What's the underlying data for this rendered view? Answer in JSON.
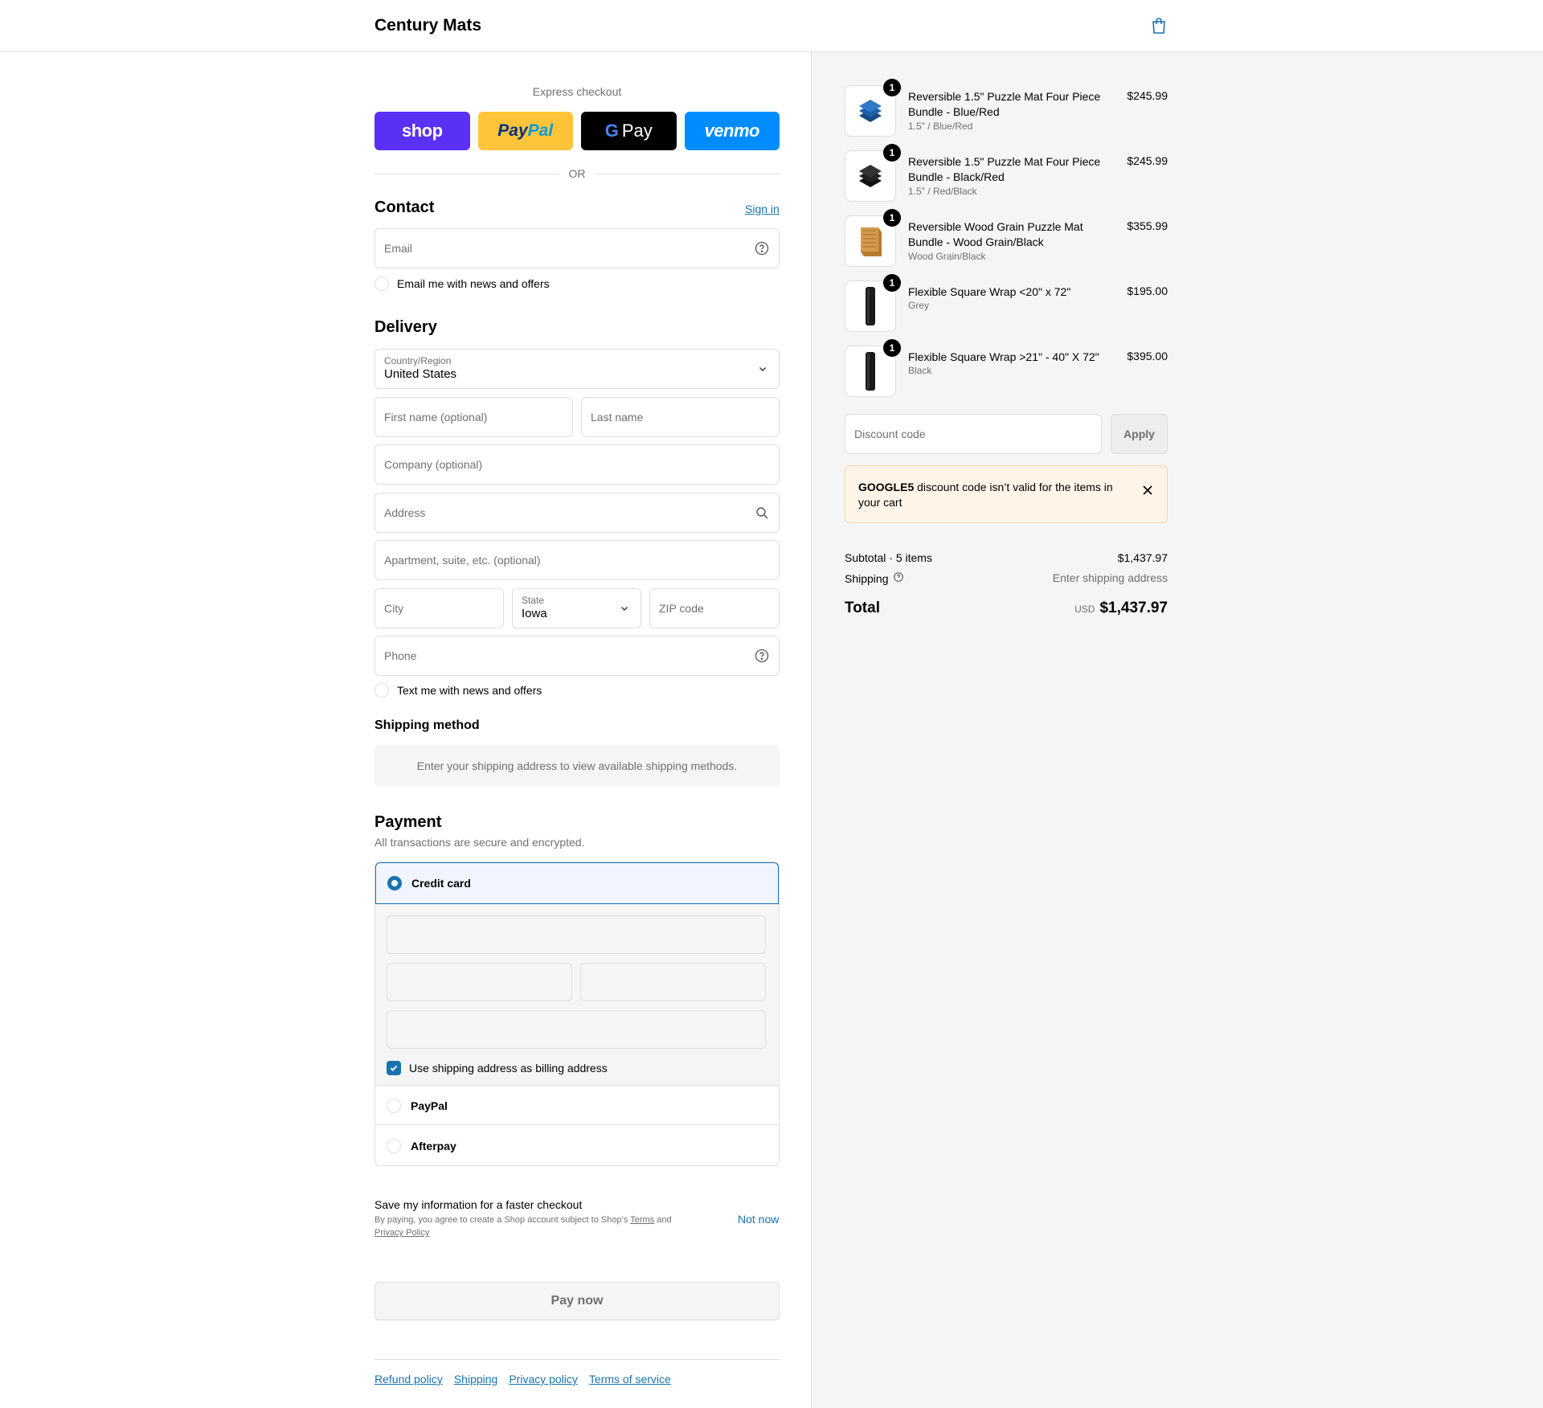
{
  "header": {
    "brand": "Century Mats",
    "cart_icon": "shopping-bag-icon"
  },
  "express": {
    "title": "Express checkout",
    "buttons": {
      "shop": "shop",
      "paypal_a": "Pay",
      "paypal_b": "Pal",
      "gpay_g": "G",
      "gpay": "Pay",
      "venmo": "venmo"
    },
    "or": "OR"
  },
  "contact": {
    "title": "Contact",
    "sign_in": "Sign in",
    "email_placeholder": "Email",
    "news_label": "Email me with news and offers"
  },
  "delivery": {
    "title": "Delivery",
    "country_label": "Country/Region",
    "country_value": "United States",
    "first_name": "First name (optional)",
    "last_name": "Last name",
    "company": "Company (optional)",
    "address": "Address",
    "apartment": "Apartment, suite, etc. (optional)",
    "city": "City",
    "state_label": "State",
    "state_value": "Iowa",
    "zip": "ZIP code",
    "phone": "Phone",
    "text_label": "Text me with news and offers"
  },
  "shipping_method": {
    "title": "Shipping method",
    "message": "Enter your shipping address to view available shipping methods."
  },
  "payment": {
    "title": "Payment",
    "subtitle": "All transactions are secure and encrypted.",
    "credit_card": "Credit card",
    "billing_label": "Use shipping address as billing address",
    "paypal": "PayPal",
    "afterpay": "Afterpay"
  },
  "save_info": {
    "title": "Save my information for a faster checkout",
    "sub_a": "By paying, you agree to create a Shop account subject to Shop’s ",
    "terms": "Terms",
    "sub_b": " and",
    "privacy": "Privacy Policy",
    "not_now": "Not now"
  },
  "pay_now": "Pay now",
  "footer": {
    "links": [
      "Refund policy",
      "Shipping",
      "Privacy policy",
      "Terms of service"
    ]
  },
  "cart": {
    "items": [
      {
        "qty": "1",
        "name": "Reversible 1.5\" Puzzle Mat Four Piece Bundle - Blue/Red",
        "variant": "1.5\" / Blue/Red",
        "price": "$245.99",
        "color": "#1f5fa8"
      },
      {
        "qty": "1",
        "name": "Reversible 1.5\" Puzzle Mat Four Piece Bundle - Black/Red",
        "variant": "1.5\" / Red/Black",
        "price": "$245.99",
        "color": "#222222"
      },
      {
        "qty": "1",
        "name": "Reversible Wood Grain Puzzle Mat Bundle - Wood Grain/Black",
        "variant": "Wood Grain/Black",
        "price": "$355.99",
        "color": "#c98a3c"
      },
      {
        "qty": "1",
        "name": "Flexible Square Wrap <20\" x 72\"",
        "variant": "Grey",
        "price": "$195.00",
        "color": "#1a1a1a"
      },
      {
        "qty": "1",
        "name": "Flexible Square Wrap >21\" - 40\" X 72\"",
        "variant": "Black",
        "price": "$395.00",
        "color": "#1a1a1a"
      }
    ],
    "discount_placeholder": "Discount code",
    "apply": "Apply",
    "warning_code": "GOOGLE5",
    "warning_text": " discount code isn’t valid for the items in your cart",
    "subtotal_label": "Subtotal · 5 items",
    "subtotal_value": "$1,437.97",
    "shipping_label": "Shipping",
    "shipping_value": "Enter shipping address",
    "total_label": "Total",
    "currency": "USD",
    "total_value": "$1,437.97"
  },
  "colors": {
    "accent": "#1773b0",
    "shop": "#5a31f4",
    "paypal": "#ffc439",
    "venmo": "#008cff"
  }
}
